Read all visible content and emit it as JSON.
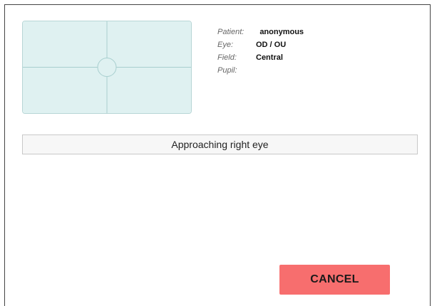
{
  "patient_info": {
    "patient": {
      "label": "Patient:",
      "value": "anonymous"
    },
    "eye": {
      "label": "Eye:",
      "value": "OD / OU"
    },
    "field": {
      "label": "Field:",
      "value": "Central"
    },
    "pupil": {
      "label": "Pupil:",
      "value": ""
    }
  },
  "status": {
    "message": "Approaching right eye"
  },
  "actions": {
    "cancel_label": "CANCEL"
  },
  "colors": {
    "preview_fill": "#dff1f1",
    "preview_lines": "#a8cfcf",
    "cancel_bg": "#f76e6e"
  },
  "icons": {
    "preview": "eye-crosshair-icon"
  }
}
